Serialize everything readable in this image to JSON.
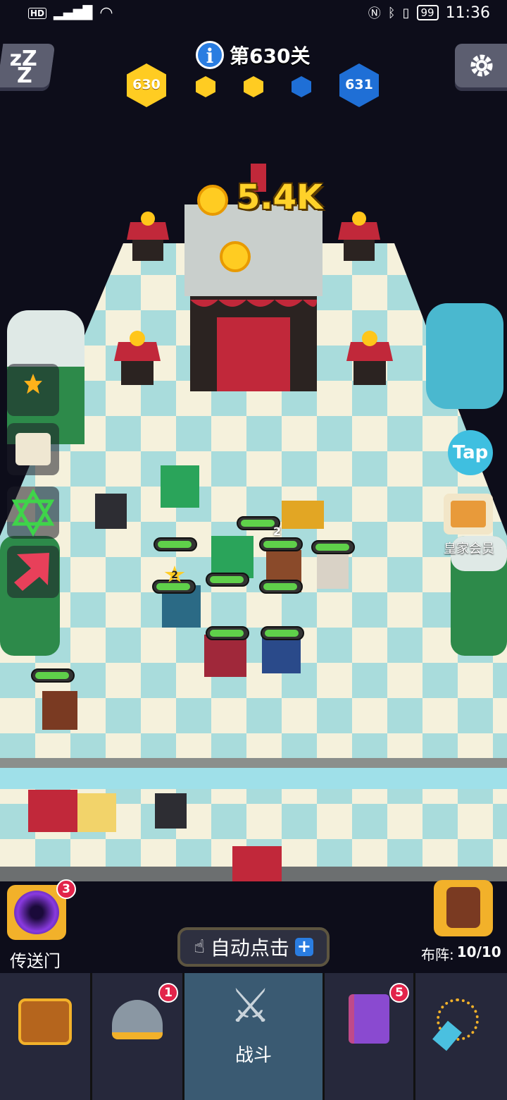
{
  "status_bar": {
    "left": "HD 5G",
    "battery": "99",
    "time": "11:36"
  },
  "hud": {
    "level_title": "第630关",
    "current_level": "630",
    "next_level": "631",
    "sleep_icon_text": "zZZ"
  },
  "battle": {
    "gold_reward": "5.4K",
    "tap_label": "Tap",
    "royal_label": "皇家会员"
  },
  "left_sidebar": [
    "trophy-icon",
    "scroll-map-icon",
    "hexagram-icon",
    "red-arrow-icon"
  ],
  "unit_level_badges": [
    "2",
    "2"
  ],
  "portal": {
    "label": "传送门",
    "badge": "3"
  },
  "auto_click": {
    "label": "自动点击",
    "plus": "+"
  },
  "formation": {
    "label": "布阵:",
    "value": "10/10"
  },
  "dock": {
    "tabs": [
      {
        "name": "treasure-chest",
        "badge": ""
      },
      {
        "name": "heroes-helmet",
        "badge": "1"
      },
      {
        "name": "battle",
        "label": "战斗",
        "badge": ""
      },
      {
        "name": "spellbook",
        "badge": "5"
      },
      {
        "name": "amulet",
        "badge": ""
      }
    ]
  },
  "colors": {
    "gold": "#ffd12a",
    "level_hex": "#ffcc22",
    "next_hex": "#1f6fd6",
    "badge": "#e2244a",
    "active_tab": "#3a5a72"
  }
}
